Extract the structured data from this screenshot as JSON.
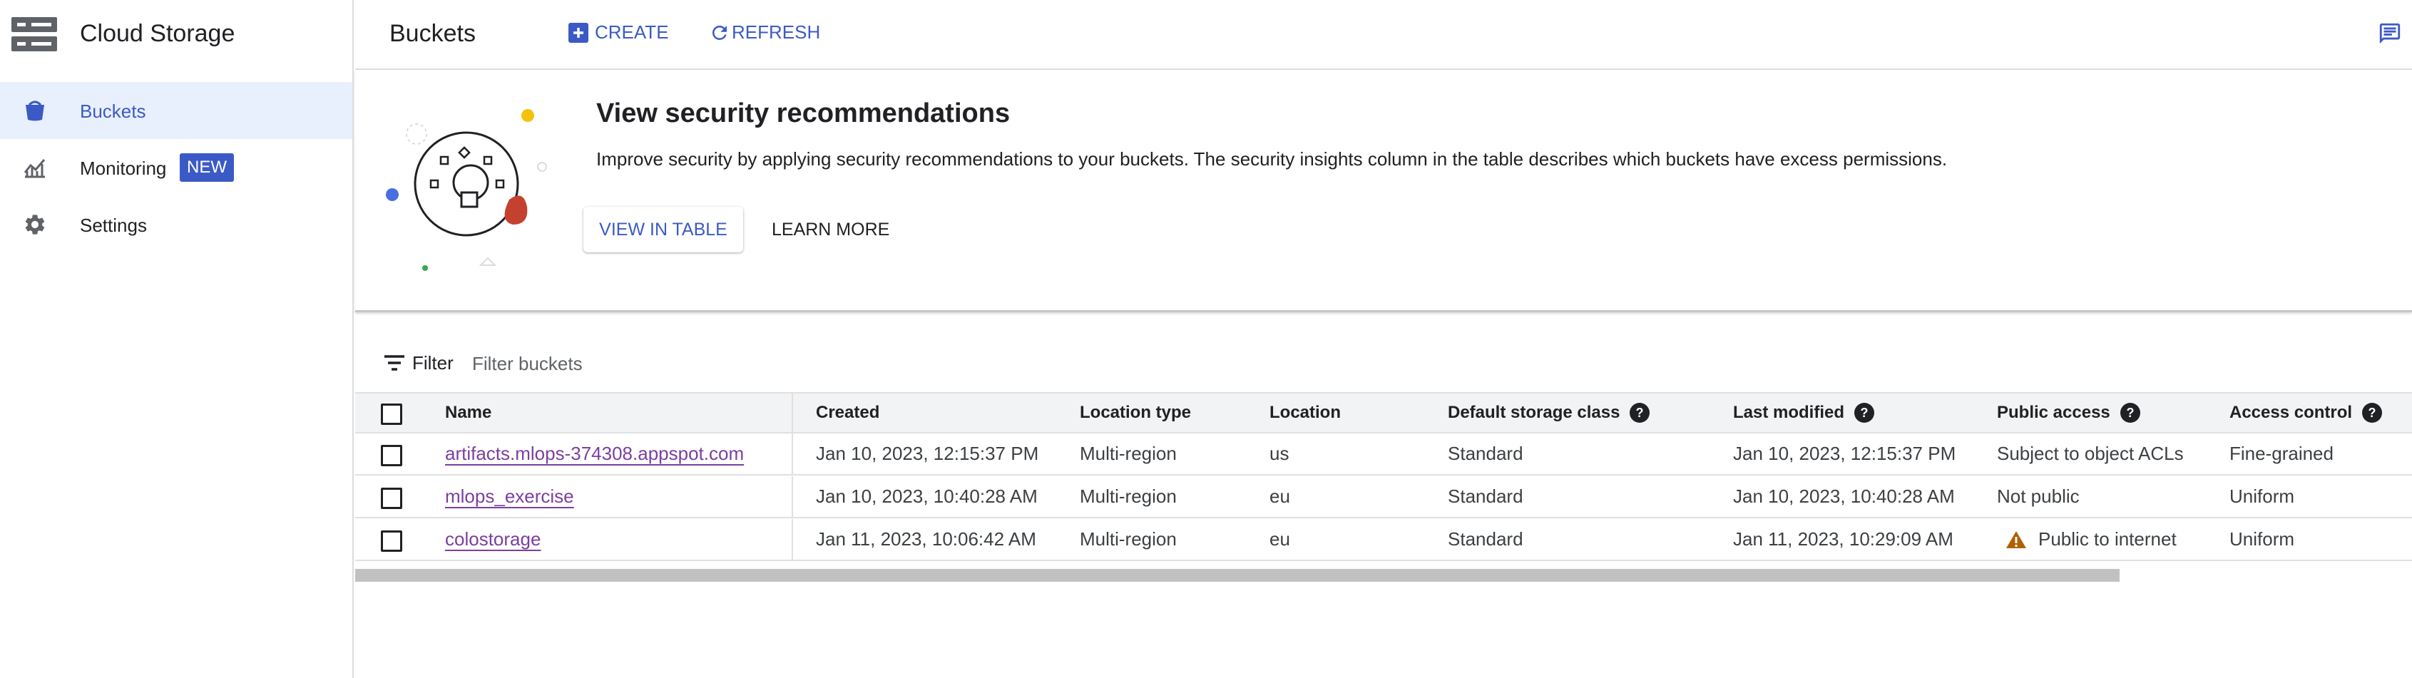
{
  "sidebar": {
    "title": "Cloud Storage",
    "logo_icon": "storage-server-icon",
    "items": [
      {
        "label": "Buckets",
        "icon": "bucket-icon",
        "active": true
      },
      {
        "label": "Monitoring",
        "icon": "monitoring-chart-icon",
        "badge": "NEW"
      },
      {
        "label": "Settings",
        "icon": "gear-icon"
      }
    ]
  },
  "topbar": {
    "title": "Buckets",
    "create_label": "CREATE",
    "refresh_label": "REFRESH"
  },
  "banner": {
    "title": "View security recommendations",
    "text": "Improve security by applying security recommendations to your buckets. The security insights column in the table describes which buckets have excess permissions.",
    "view_button": "VIEW IN TABLE",
    "learn_button": "LEARN MORE"
  },
  "filter": {
    "label": "Filter",
    "placeholder": "Filter buckets"
  },
  "table": {
    "headers": {
      "name": "Name",
      "created": "Created",
      "location_type": "Location type",
      "location": "Location",
      "storage_class": "Default storage class",
      "last_modified": "Last modified",
      "public_access": "Public access",
      "access_control": "Access control"
    },
    "rows": [
      {
        "name": "artifacts.mlops-374308.appspot.com",
        "created": "Jan 10, 2023, 12:15:37 PM",
        "location_type": "Multi-region",
        "location": "us",
        "storage_class": "Standard",
        "last_modified": "Jan 10, 2023, 12:15:37 PM",
        "public_access": "Subject to object ACLs",
        "access_control": "Fine-grained"
      },
      {
        "name": "mlops_exercise",
        "created": "Jan 10, 2023, 10:40:28 AM",
        "location_type": "Multi-region",
        "location": "eu",
        "storage_class": "Standard",
        "last_modified": "Jan 10, 2023, 10:40:28 AM",
        "public_access": "Not public",
        "access_control": "Uniform"
      },
      {
        "name": "colostorage",
        "created": "Jan 11, 2023, 10:06:42 AM",
        "location_type": "Multi-region",
        "location": "eu",
        "storage_class": "Standard",
        "last_modified": "Jan 11, 2023, 10:29:09 AM",
        "public_access": "Public to internet",
        "public_access_warning": true,
        "access_control": "Uniform"
      }
    ]
  },
  "colors": {
    "accent": "#3c5ac6",
    "link": "#7b3fa0",
    "warning": "#b06000",
    "active_nav_bg": "#e8f0fe"
  }
}
